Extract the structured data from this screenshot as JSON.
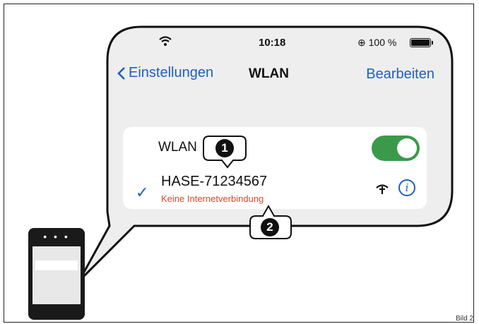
{
  "status_bar": {
    "time": "10:18",
    "battery": "100 %"
  },
  "nav": {
    "back_label": "Einstellungen",
    "title": "WLAN",
    "edit_label": "Bearbeiten"
  },
  "wlan": {
    "label": "WLAN",
    "enabled": true
  },
  "network": {
    "name": "HASE-71234567",
    "status": "Keine Internetverbindung",
    "connected": true
  },
  "callouts": {
    "one": "1",
    "two": "2"
  },
  "caption": "Bild 2",
  "colors": {
    "accent": "#1f5fbf",
    "toggle_on": "#3a9a4a",
    "error": "#d44a2a",
    "screen_bg": "#eeeeee"
  }
}
